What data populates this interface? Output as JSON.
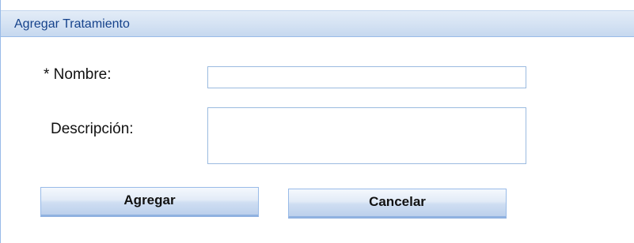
{
  "panel": {
    "title": "Agregar Tratamiento"
  },
  "form": {
    "nombre_label": "* Nombre:",
    "nombre_value": "",
    "descripcion_label": "Descripción:",
    "descripcion_value": ""
  },
  "buttons": {
    "agregar_label": "Agregar",
    "cancelar_label": "Cancelar"
  },
  "colors": {
    "title_text": "#15428b",
    "header_bg": "#d4e2f3",
    "border": "#99bbe8"
  }
}
